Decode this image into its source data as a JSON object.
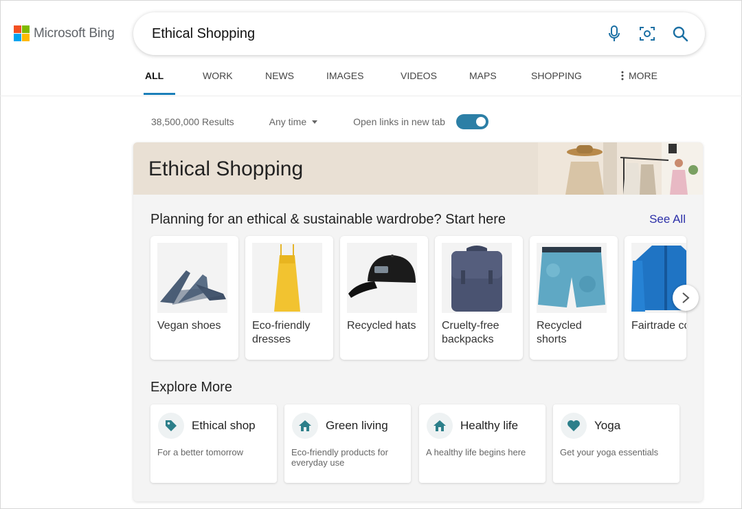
{
  "brand": {
    "name": "Microsoft Bing",
    "logo_colors": [
      "#f25022",
      "#7fba00",
      "#00a4ef",
      "#ffb900"
    ]
  },
  "search": {
    "query": "Ethical Shopping",
    "icons": [
      "microphone-icon",
      "visual-search-icon",
      "search-icon"
    ]
  },
  "tabs": [
    {
      "label": "ALL",
      "active": true
    },
    {
      "label": "WORK"
    },
    {
      "label": "NEWS"
    },
    {
      "label": "IMAGES"
    },
    {
      "label": "VIDEOS"
    },
    {
      "label": "MAPS"
    },
    {
      "label": "SHOPPING"
    },
    {
      "label": "MORE",
      "icon": "vertical-dots-icon"
    }
  ],
  "toolbar": {
    "results_count": "38,500,000 Results",
    "time_filter": "Any time",
    "new_tab_label": "Open links in new tab",
    "new_tab_enabled": true
  },
  "answer": {
    "banner_title": "Ethical Shopping",
    "wardrobe_heading": "Planning for an ethical & sustainable wardrobe? Start here",
    "see_all": "See All",
    "products": [
      {
        "label": "Vegan shoes",
        "icon": "shoes-image"
      },
      {
        "label": "Eco-friendly dresses",
        "icon": "dress-image"
      },
      {
        "label": "Recycled hats",
        "icon": "cap-image"
      },
      {
        "label": "Cruelty-free backpacks",
        "icon": "backpack-image"
      },
      {
        "label": "Recycled shorts",
        "icon": "shorts-image"
      },
      {
        "label": "Fairtrade coats",
        "icon": "jacket-image"
      }
    ],
    "explore_heading": "Explore More",
    "explore": [
      {
        "title": "Ethical shop",
        "desc": "For a better tomorrow",
        "icon": "tag-icon"
      },
      {
        "title": "Green living",
        "desc": "Eco-friendly products for everyday use",
        "icon": "home-icon"
      },
      {
        "title": "Healthy life",
        "desc": "A healthy life begins here",
        "icon": "home-icon"
      },
      {
        "title": "Yoga",
        "desc": "Get your yoga essentials",
        "icon": "heart-icon"
      }
    ]
  },
  "colors": {
    "accent_tab": "#1a7eb8",
    "toggle": "#2c7fa6",
    "icon_teal": "#2c7f8a",
    "link": "#2b2fa8",
    "banner_bg": "#e9e0d4"
  }
}
